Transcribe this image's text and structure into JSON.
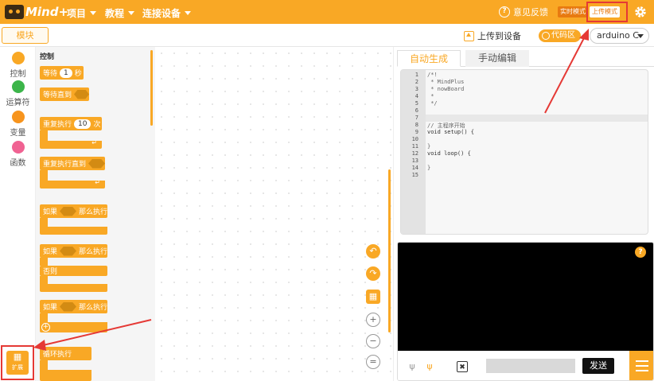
{
  "topbar": {
    "logo_text": "Mind+",
    "menus": [
      "项目",
      "教程",
      "连接设备"
    ],
    "feedback": "意见反馈",
    "mode_live": "实时模式",
    "mode_upload": "上传模式"
  },
  "subbar": {
    "modules_tab": "模块",
    "upload_to_device": "上传到设备",
    "code_area": "代码区",
    "board": "arduino C"
  },
  "categories": [
    {
      "label": "控制",
      "color": "#f9a825"
    },
    {
      "label": "运算符",
      "color": "#3cb54a"
    },
    {
      "label": "变量",
      "color": "#f7941d"
    },
    {
      "label": "函数",
      "color": "#f06292"
    }
  ],
  "extension": {
    "label": "扩展"
  },
  "palette": {
    "title": "控制",
    "wait": {
      "pre": "等待",
      "value": "1",
      "post": "秒"
    },
    "wait_until": "等待直到",
    "repeat": {
      "pre": "重复执行",
      "value": "10",
      "post": "次"
    },
    "repeat_until": "重复执行直到",
    "if_then": {
      "pre": "如果",
      "post": "那么执行"
    },
    "if_else": {
      "pre": "如果",
      "post": "那么执行",
      "else": "否则"
    },
    "if_plus": {
      "pre": "如果",
      "post": "那么执行"
    },
    "forever": "循环执行"
  },
  "code_tabs": {
    "auto": "自动生成",
    "manual": "手动编辑"
  },
  "code": {
    "line_numbers": [
      "1",
      "2",
      "3",
      "4",
      "5",
      "6",
      "7",
      "8",
      "9",
      "10",
      "11",
      "12",
      "13",
      "14",
      "15"
    ],
    "lines": [
      "/*!",
      " * MindPlus",
      " * nowBoard",
      " *",
      " */",
      "",
      "",
      "// 主程序开始",
      "void setup() {",
      "",
      "}",
      "void loop() {",
      "",
      "}",
      ""
    ]
  },
  "serial": {
    "help": "?",
    "send": "发送"
  },
  "colors": {
    "accent": "#f9a825",
    "highlight": "#e53935"
  }
}
